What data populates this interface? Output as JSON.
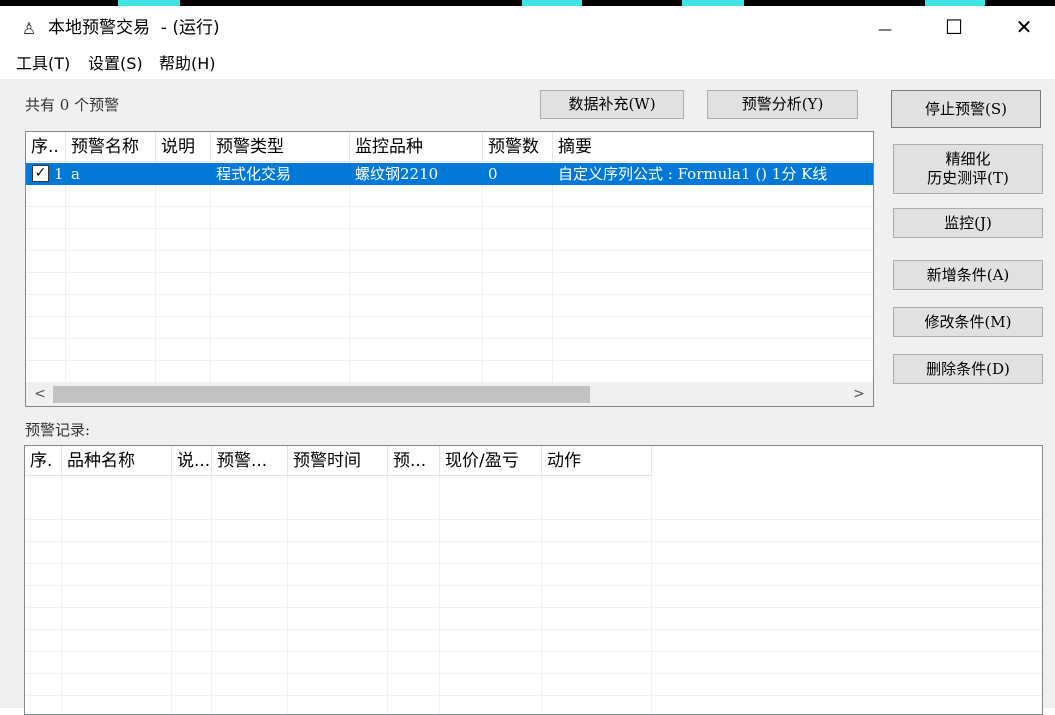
{
  "window": {
    "title": "本地预警交易  - (运行)",
    "app_icon": "bell-icon",
    "minimize_glyph": "—",
    "maximize_glyph": "☐",
    "close_glyph": "✕"
  },
  "menu": {
    "items": [
      {
        "label": "工具(T)"
      },
      {
        "label": "设置(S)"
      },
      {
        "label": "帮助(H)"
      }
    ]
  },
  "summary": {
    "count_text": "共有 0 个预警"
  },
  "buttons": {
    "data_fill": "数据补充(W)",
    "alert_analysis": "预警分析(Y)",
    "stop_alert": "停止预警(S)",
    "backtest": "精细化\n历史测评(T)",
    "monitor": "监控(J)",
    "add_condition": "新增条件(A)",
    "modify_condition": "修改条件(M)",
    "delete_condition": "删除条件(D)"
  },
  "alert_list": {
    "columns": [
      "序..",
      "预警名称",
      "说明",
      "预警类型",
      "监控品种",
      "预警数",
      "摘要"
    ],
    "rows": [
      {
        "checked": true,
        "index": "1",
        "name": "a",
        "desc": "",
        "type": "程式化交易",
        "symbol": "螺纹钢2210",
        "count": "0",
        "summary": "自定义序列公式 : Formula1 () 1分 K线"
      }
    ],
    "scroll_left": "<",
    "scroll_right": ">"
  },
  "records": {
    "label": "预警记录:",
    "columns": [
      "序.",
      "品种名称",
      "说...",
      "预警...",
      "预警时间",
      "预...",
      "现价/盈亏",
      "动作"
    ]
  },
  "colors": {
    "selection": "#0078d7",
    "client_bg": "#f0f0f0",
    "button_bg": "#e1e1e1"
  }
}
